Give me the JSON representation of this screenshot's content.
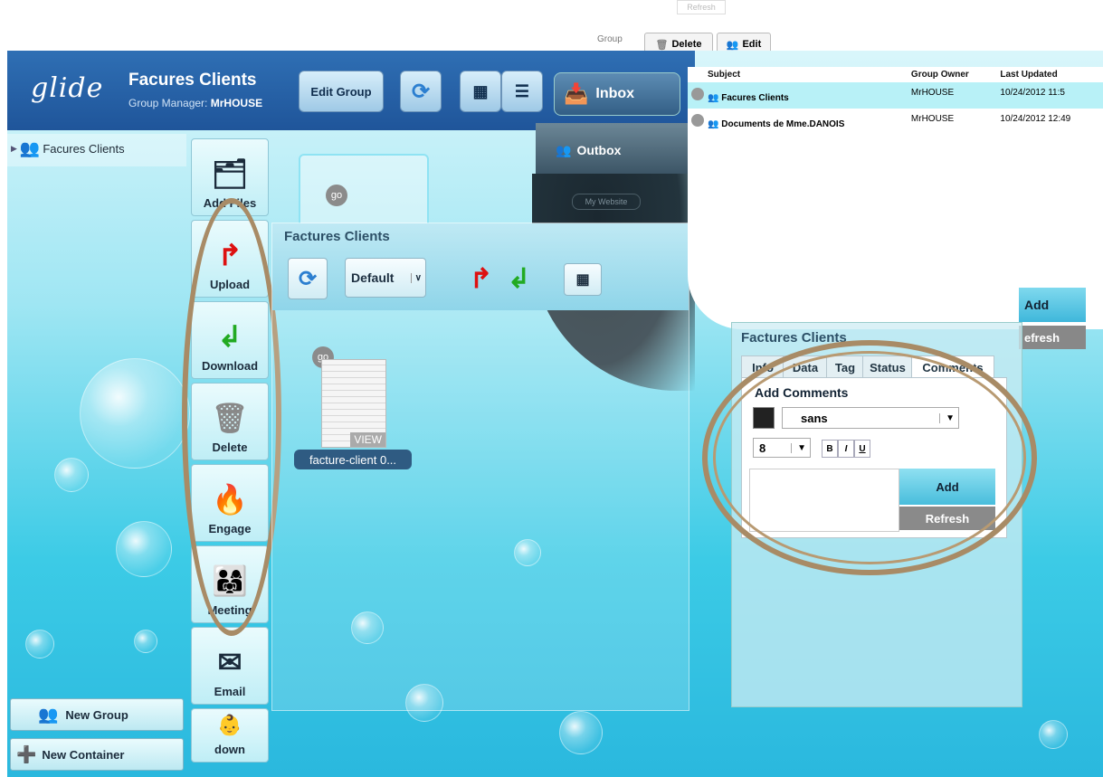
{
  "topstrip": {
    "refresh_label": "Refresh",
    "group_label": "Group",
    "delete_label": "Delete",
    "edit_label": "Edit"
  },
  "app": {
    "logo": "glide",
    "group_title": "Facures Clients",
    "group_manager_label": "Group Manager:",
    "group_manager": "MrHOUSE",
    "edit_group": "Edit Group",
    "inbox": "Inbox",
    "outbox": "Outbox",
    "my_website": "My Website"
  },
  "tree": {
    "item": "Facures Clients"
  },
  "sidebar": {
    "items": [
      {
        "label": "Add Files",
        "icon": "add-files-icon"
      },
      {
        "label": "Upload",
        "icon": "upload-arrow-icon"
      },
      {
        "label": "Download",
        "icon": "download-arrow-icon"
      },
      {
        "label": "Delete",
        "icon": "trash-icon"
      },
      {
        "label": "Engage",
        "icon": "engage-icon"
      },
      {
        "label": "Meeting",
        "icon": "meeting-icon"
      },
      {
        "label": "Email",
        "icon": "email-icon"
      },
      {
        "label": "down",
        "icon": "avatar-icon"
      }
    ]
  },
  "bottom": {
    "new_group": "New Group",
    "new_container": "New Container"
  },
  "files_panel": {
    "title": "Factures Clients",
    "view_select": "Default",
    "go": "go",
    "file_name": "facture-client 0...",
    "view_badge": "VIEW"
  },
  "inbox_list": {
    "headers": [
      "Subject",
      "Group Owner",
      "Last Updated"
    ],
    "rows": [
      {
        "subject": "Facures Clients",
        "owner": "MrHOUSE",
        "updated": "10/24/2012 11:5"
      },
      {
        "subject": "Documents de Mme.DANOIS",
        "owner": "MrHOUSE",
        "updated": "10/24/2012 12:49"
      }
    ],
    "add": "Add",
    "refresh": "efresh"
  },
  "details_panel": {
    "title": "Factures Clients",
    "tabs": [
      "Info",
      "Data",
      "Tag",
      "Status",
      "Comments"
    ],
    "add_comments": "Add Comments",
    "font": "sans",
    "size": "8",
    "bold": "B",
    "italic": "I",
    "underline": "U",
    "add": "Add",
    "refresh": "Refresh"
  }
}
